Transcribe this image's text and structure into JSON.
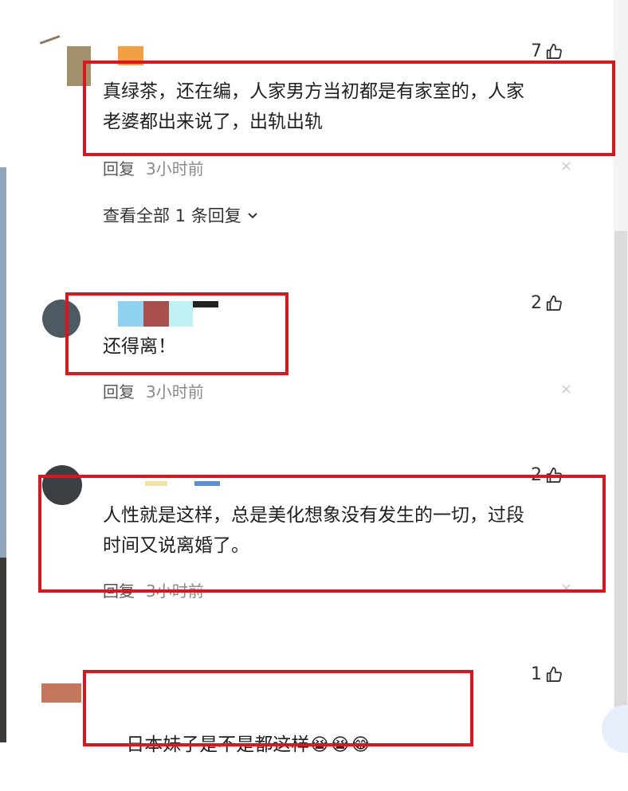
{
  "comments": [
    {
      "likes": "7",
      "text": "真绿茶，还在编，人家男方当初都是有家室的，人家\n老婆都出来说了，出轨出轨",
      "reply_label": "回复",
      "time": "3小时前"
    },
    {
      "likes": "2",
      "text": "还得离！",
      "reply_label": "回复",
      "time": "3小时前"
    },
    {
      "likes": "2",
      "text": "人性就是这样，总是美化想象没有发生的一切，过段\n时间又说离婚了。",
      "reply_label": "回复",
      "time": "3小时前"
    },
    {
      "likes": "1",
      "text": "日本妹子是不是都这样",
      "emojis": "😭😭😂"
    }
  ],
  "view_all_replies": "查看全部 1 条回复",
  "close_glyph": "×",
  "colors": {
    "highlight_border": "#e0141c"
  }
}
